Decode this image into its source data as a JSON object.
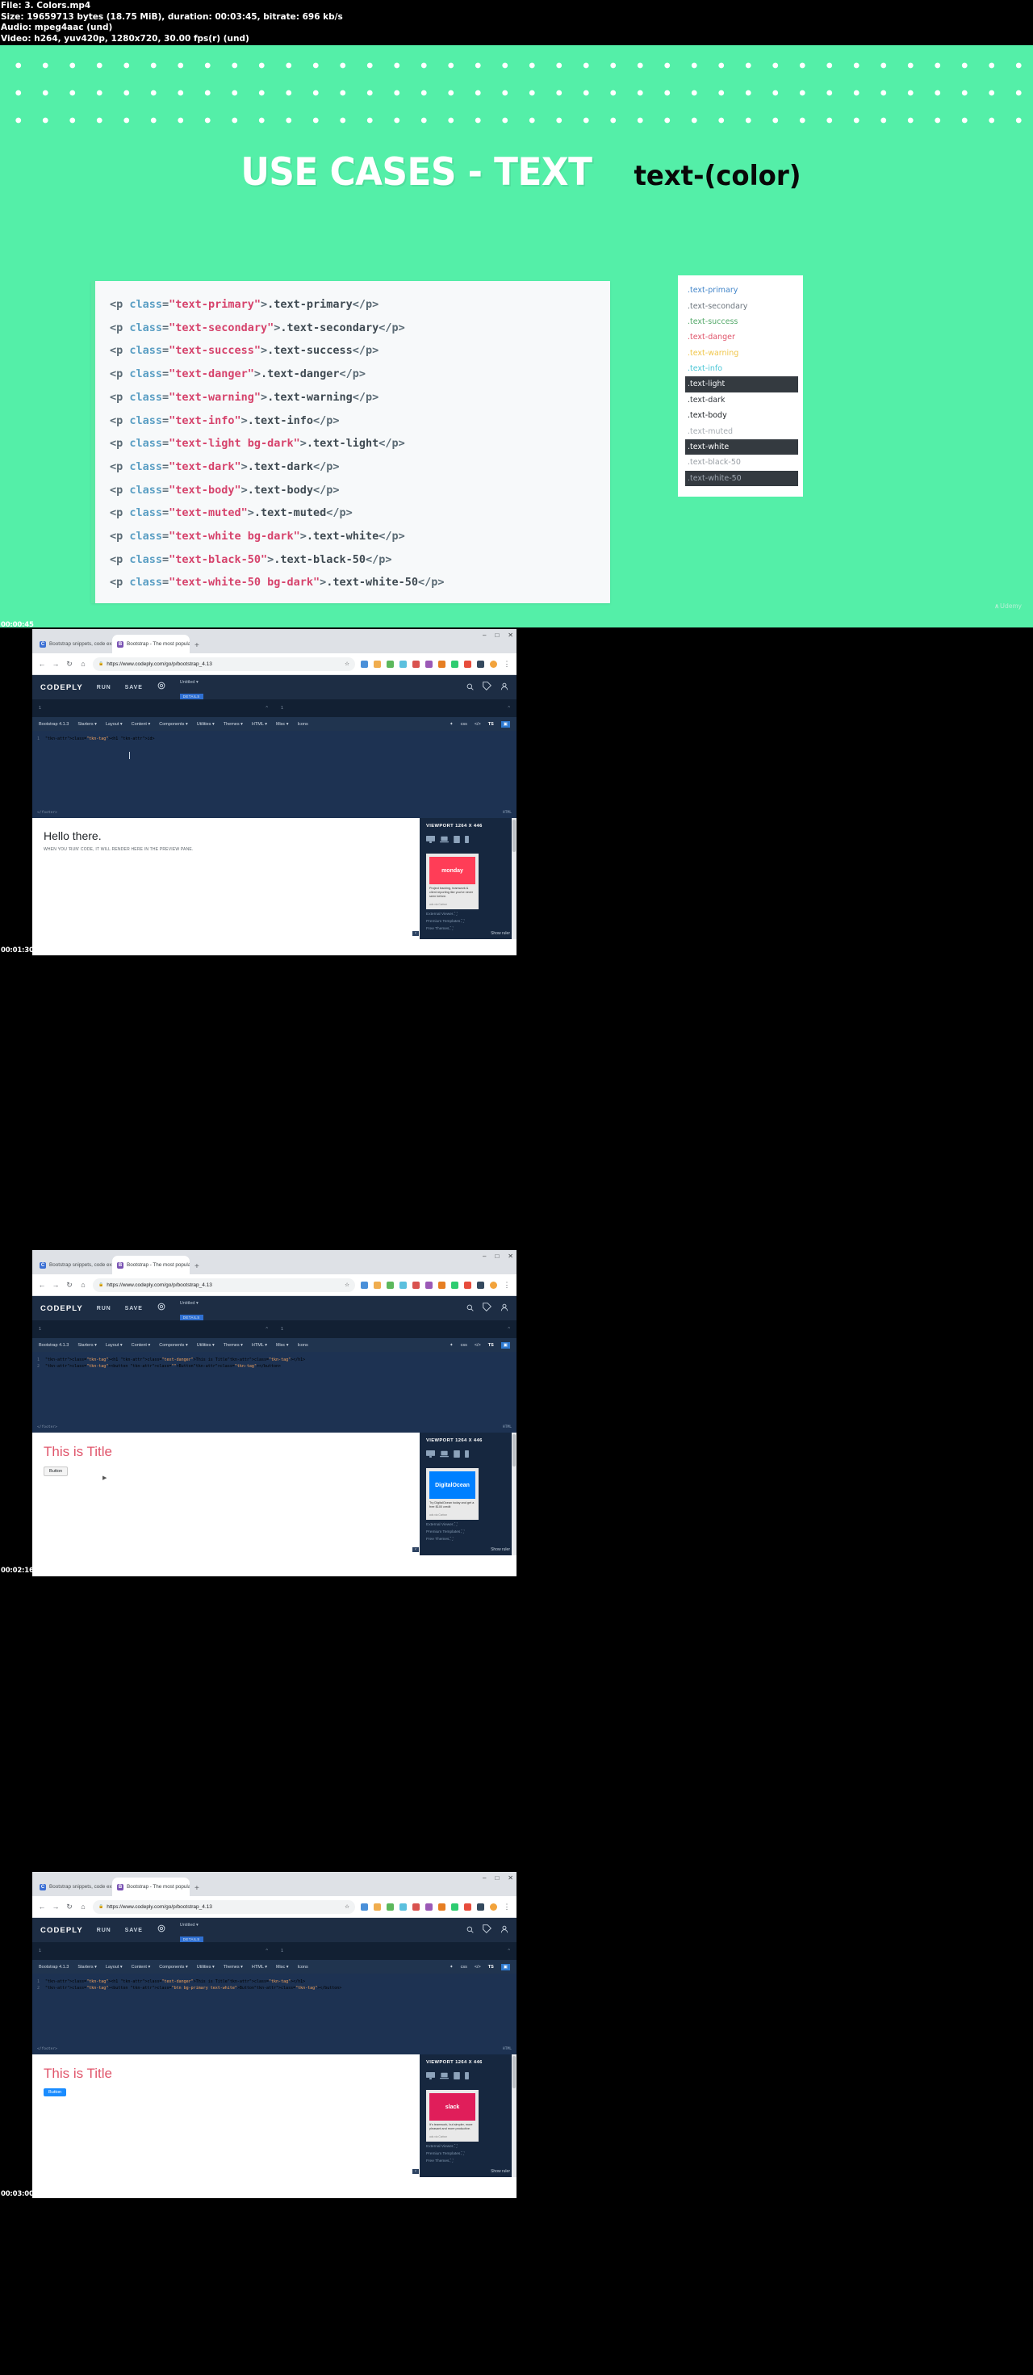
{
  "file_info": {
    "line1": "File: 3. Colors.mp4",
    "line2": "Size: 19659713 bytes (18.75 MiB), duration: 00:03:45, bitrate: 696 kb/s",
    "line3": "Audio: mpeg4aac (und)",
    "line4": "Video: h264, yuv420p, 1280x720, 30.00 fps(r) (und)"
  },
  "slide": {
    "title": "USE CASES - TEXT",
    "subtitle": "text-(color)",
    "bg_color": "#54EFA8",
    "code_lines": [
      {
        "tag_open": "<p ",
        "attr": "class",
        "eq": "=",
        "value": "\"text-primary\"",
        "gt": ">",
        "text": ".text-primary",
        "tag_close": "</p>"
      },
      {
        "tag_open": "<p ",
        "attr": "class",
        "eq": "=",
        "value": "\"text-secondary\"",
        "gt": ">",
        "text": ".text-secondary",
        "tag_close": "</p>"
      },
      {
        "tag_open": "<p ",
        "attr": "class",
        "eq": "=",
        "value": "\"text-success\"",
        "gt": ">",
        "text": ".text-success",
        "tag_close": "</p>"
      },
      {
        "tag_open": "<p ",
        "attr": "class",
        "eq": "=",
        "value": "\"text-danger\"",
        "gt": ">",
        "text": ".text-danger",
        "tag_close": "</p>"
      },
      {
        "tag_open": "<p ",
        "attr": "class",
        "eq": "=",
        "value": "\"text-warning\"",
        "gt": ">",
        "text": ".text-warning",
        "tag_close": "</p>"
      },
      {
        "tag_open": "<p ",
        "attr": "class",
        "eq": "=",
        "value": "\"text-info\"",
        "gt": ">",
        "text": ".text-info",
        "tag_close": "</p>"
      },
      {
        "tag_open": "<p ",
        "attr": "class",
        "eq": "=",
        "value": "\"text-light bg-dark\"",
        "gt": ">",
        "text": ".text-light",
        "tag_close": "</p>"
      },
      {
        "tag_open": "<p ",
        "attr": "class",
        "eq": "=",
        "value": "\"text-dark\"",
        "gt": ">",
        "text": ".text-dark",
        "tag_close": "</p>"
      },
      {
        "tag_open": "<p ",
        "attr": "class",
        "eq": "=",
        "value": "\"text-body\"",
        "gt": ">",
        "text": ".text-body",
        "tag_close": "</p>"
      },
      {
        "tag_open": "<p ",
        "attr": "class",
        "eq": "=",
        "value": "\"text-muted\"",
        "gt": ">",
        "text": ".text-muted",
        "tag_close": "</p>"
      },
      {
        "tag_open": "<p ",
        "attr": "class",
        "eq": "=",
        "value": "\"text-white bg-dark\"",
        "gt": ">",
        "text": ".text-white",
        "tag_close": "</p>"
      },
      {
        "tag_open": "<p ",
        "attr": "class",
        "eq": "=",
        "value": "\"text-black-50\"",
        "gt": ">",
        "text": ".text-black-50",
        "tag_close": "</p>"
      },
      {
        "tag_open": "<p ",
        "attr": "class",
        "eq": "=",
        "value": "\"text-white-50 bg-dark\"",
        "gt": ">",
        "text": ".text-white-50",
        "tag_close": "</p>"
      }
    ],
    "preview_items": [
      {
        "label": ".text-primary",
        "color": "#4285c9",
        "bg": "transparent"
      },
      {
        "label": ".text-secondary",
        "color": "#6c757d",
        "bg": "transparent"
      },
      {
        "label": ".text-success",
        "color": "#54a96a",
        "bg": "transparent"
      },
      {
        "label": ".text-danger",
        "color": "#e0556b",
        "bg": "transparent"
      },
      {
        "label": ".text-warning",
        "color": "#f0c64a",
        "bg": "transparent"
      },
      {
        "label": ".text-info",
        "color": "#4bc6d6",
        "bg": "transparent"
      },
      {
        "label": ".text-light",
        "color": "#f3f5f7",
        "bg": "#343a40"
      },
      {
        "label": ".text-dark",
        "color": "#343a40",
        "bg": "transparent"
      },
      {
        "label": ".text-body",
        "color": "#212529",
        "bg": "transparent"
      },
      {
        "label": ".text-muted",
        "color": "#a6acb2",
        "bg": "transparent"
      },
      {
        "label": ".text-white",
        "color": "#ffffff",
        "bg": "#343a40"
      },
      {
        "label": ".text-black-50",
        "color": "#9aa0a6",
        "bg": "transparent"
      },
      {
        "label": ".text-white-50",
        "color": "#9fa7b0",
        "bg": "#343a40"
      }
    ],
    "watermark": "Udemy"
  },
  "timestamps": {
    "t0": "00:00:45",
    "t1": "00:01:30",
    "t2": "00:02:16",
    "t3": "00:03:00"
  },
  "browser": {
    "tab_inactive": "Bootstrap snippets, code examp…",
    "tab_active": "Bootstrap - The most popular fr…",
    "tab_inactive_fav": "C",
    "tab_active_fav": "B",
    "new_tab": "+",
    "win_min": "–",
    "win_max": "□",
    "win_close": "✕",
    "back": "←",
    "forward": "→",
    "reload": "↻",
    "home": "⌂",
    "lock": "🔒",
    "url": "https://www.codeply.com/go/p/bootstrap_4.13",
    "star": "☆",
    "profile": "👤"
  },
  "codeply": {
    "logo": "CODEPLY",
    "run": "RUN",
    "save": "SAVE",
    "gear_icon": "gear-icon",
    "project_name": "Untitled",
    "details_badge": "DETAILS",
    "search_icon": "search-icon",
    "tag_icon": "tag-icon",
    "user_icon": "user-icon",
    "nav_items": [
      "Bootstrap 4.1.3",
      "Starters",
      "Layout",
      "Content",
      "Components",
      "Utilities",
      "Themes",
      "HTML",
      "Misc",
      "Icons"
    ],
    "tool_icons": [
      "wand-icon",
      "css-icon",
      "code-icon",
      "ts-icon",
      "image-icon"
    ],
    "body_label": "<body >",
    "footer_label": "</footer>",
    "html_label": "HTML",
    "editor_line_marker": "1"
  },
  "sidebar": {
    "viewport_label": "VIEWPORT 1264 X 446",
    "device_icons": [
      "desktop-icon",
      "laptop-icon",
      "tablet-icon",
      "mobile-icon"
    ],
    "external_viewer": "External Viewer",
    "premium_templates": "Premium Templates",
    "free_themes": "Free Themes",
    "show_ruler": "Show ruler",
    "collapse": "‹",
    "ad_note": "ads via Carbon"
  },
  "shots": [
    {
      "name": "shot-1",
      "code_lines": [
        {
          "n": "1",
          "content": "<h1 id>",
          "type": "tiny"
        }
      ],
      "preview_heading": "Hello there.",
      "preview_sub": "WHEN YOU 'RUN' CODE, IT WILL RENDER HERE IN THE PREVIEW PANE.",
      "heading_color": "#212529",
      "ad_title": "Project tracking, teamwork & client reporting like you've never seen before.",
      "ad_brand": "monday",
      "ad_brand_color": "#ff3d57",
      "has_button": false
    },
    {
      "name": "shot-2",
      "code_lines": [
        {
          "n": "1",
          "content": "<h1 class=\"text-danger\">This is Title</h1>"
        },
        {
          "n": "2",
          "content": "<button class=\"\">Button</button>"
        }
      ],
      "preview_heading": "This is Title",
      "heading_color": "#e0556b",
      "button_label": "Button",
      "button_bg": "#f4f4f4",
      "button_color": "#212529",
      "ad_title": "Try DigitalOcean today and get a free $100 credit",
      "ad_brand": "DigitalOcean",
      "ad_brand_color": "#0080ff",
      "has_button": true
    },
    {
      "name": "shot-3",
      "code_lines": [
        {
          "n": "1",
          "content": "<h1 class=\"text-danger\">This is Title</h1>"
        },
        {
          "n": "2",
          "content": "<button class=\"btn bg-primary text-white\">Button</button>"
        }
      ],
      "preview_heading": "This is Title",
      "heading_color": "#e0556b",
      "button_label": "Button",
      "button_bg": "#1a8cff",
      "button_color": "#ffffff",
      "ad_title": "It's teamwork, but simpler, more pleasant and more productive.",
      "ad_brand": "slack",
      "ad_brand_color": "#e01e5a",
      "has_button": true
    }
  ]
}
